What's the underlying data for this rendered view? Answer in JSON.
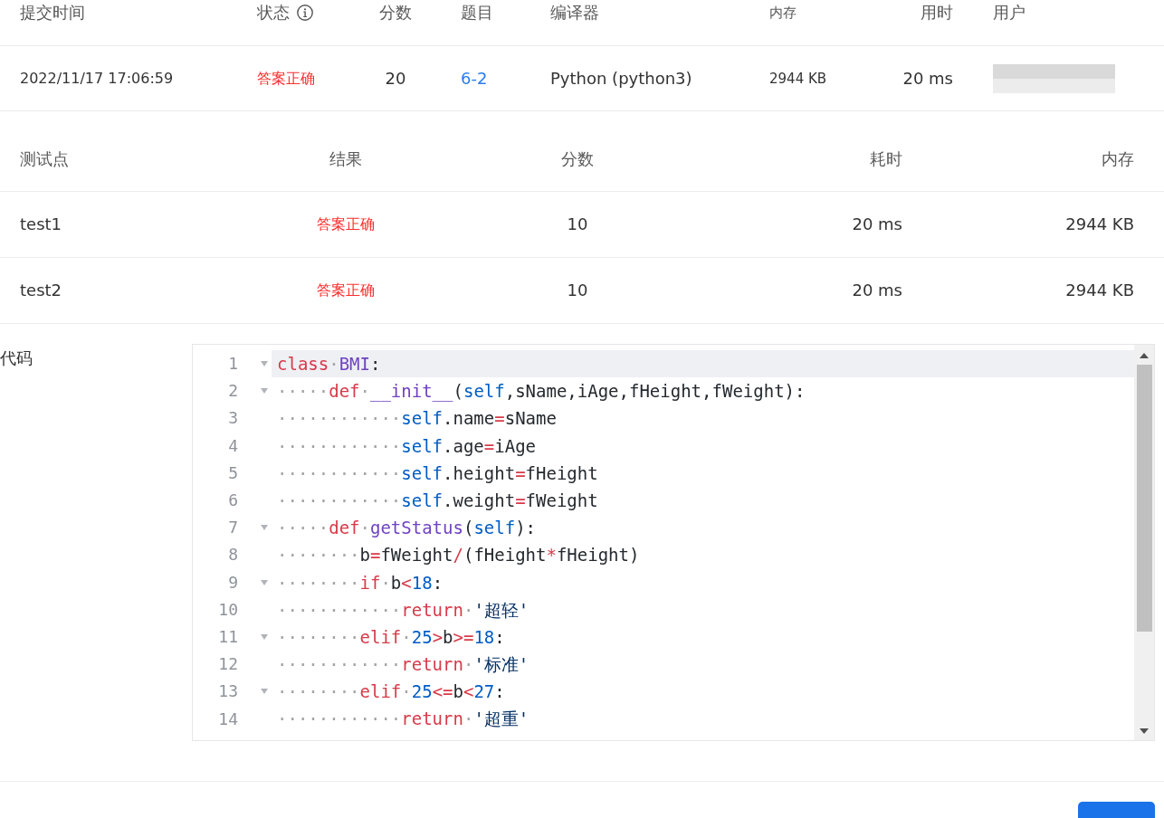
{
  "submission_table": {
    "columns": [
      {
        "label": "提交时间",
        "info": false
      },
      {
        "label": "状态",
        "info": true
      },
      {
        "label": "分数",
        "info": false
      },
      {
        "label": "题目",
        "info": false
      },
      {
        "label": "编译器",
        "info": false
      },
      {
        "label": "内存",
        "info": false
      },
      {
        "label": "用时",
        "info": false
      },
      {
        "label": "用户",
        "info": false
      }
    ],
    "rows": [
      {
        "cells": [
          {
            "kind": "plain",
            "text": "2022/11/17 17:06:59"
          },
          {
            "kind": "status",
            "text": "答案正确"
          },
          {
            "kind": "plain",
            "text": "20"
          },
          {
            "kind": "link",
            "text": "6-2"
          },
          {
            "kind": "plain",
            "text": "Python (python3)"
          },
          {
            "kind": "plain",
            "text": "2944 KB"
          },
          {
            "kind": "plain",
            "text": "20 ms"
          },
          {
            "kind": "blurred"
          }
        ]
      }
    ]
  },
  "test_table": {
    "columns": [
      "测试点",
      "结果",
      "分数",
      "耗时",
      "内存"
    ],
    "rows": [
      {
        "cells": [
          {
            "kind": "plain",
            "text": "test1"
          },
          {
            "kind": "status",
            "text": "答案正确"
          },
          {
            "kind": "plain",
            "text": "10"
          },
          {
            "kind": "plain",
            "text": "20 ms"
          },
          {
            "kind": "plain",
            "text": "2944 KB"
          }
        ]
      },
      {
        "cells": [
          {
            "kind": "plain",
            "text": "test2"
          },
          {
            "kind": "status",
            "text": "答案正确"
          },
          {
            "kind": "plain",
            "text": "10"
          },
          {
            "kind": "plain",
            "text": "20 ms"
          },
          {
            "kind": "plain",
            "text": "2944 KB"
          }
        ]
      }
    ]
  },
  "code": {
    "label": "代码",
    "lines": [
      {
        "number": "1",
        "foldable": true,
        "active": true,
        "tokens": [
          {
            "kind": "keyword",
            "text": "class"
          },
          {
            "kind": "ws",
            "text": "·"
          },
          {
            "kind": "name",
            "text": "BMI"
          },
          {
            "kind": "plain",
            "text": ":"
          }
        ]
      },
      {
        "number": "2",
        "foldable": true,
        "active": false,
        "tokens": [
          {
            "kind": "ws",
            "text": "·····"
          },
          {
            "kind": "keyword",
            "text": "def"
          },
          {
            "kind": "ws",
            "text": "·"
          },
          {
            "kind": "name",
            "text": "__init__"
          },
          {
            "kind": "plain",
            "text": "("
          },
          {
            "kind": "self",
            "text": "self"
          },
          {
            "kind": "plain",
            "text": ",sName,iAge,fHeight,fWeight):"
          }
        ]
      },
      {
        "number": "3",
        "foldable": false,
        "active": false,
        "tokens": [
          {
            "kind": "ws",
            "text": "············"
          },
          {
            "kind": "self",
            "text": "self"
          },
          {
            "kind": "plain",
            "text": ".name"
          },
          {
            "kind": "op",
            "text": "="
          },
          {
            "kind": "plain",
            "text": "sName"
          }
        ]
      },
      {
        "number": "4",
        "foldable": false,
        "active": false,
        "tokens": [
          {
            "kind": "ws",
            "text": "············"
          },
          {
            "kind": "self",
            "text": "self"
          },
          {
            "kind": "plain",
            "text": ".age"
          },
          {
            "kind": "op",
            "text": "="
          },
          {
            "kind": "plain",
            "text": "iAge"
          }
        ]
      },
      {
        "number": "5",
        "foldable": false,
        "active": false,
        "tokens": [
          {
            "kind": "ws",
            "text": "············"
          },
          {
            "kind": "self",
            "text": "self"
          },
          {
            "kind": "plain",
            "text": ".height"
          },
          {
            "kind": "op",
            "text": "="
          },
          {
            "kind": "plain",
            "text": "fHeight"
          }
        ]
      },
      {
        "number": "6",
        "foldable": false,
        "active": false,
        "tokens": [
          {
            "kind": "ws",
            "text": "············"
          },
          {
            "kind": "self",
            "text": "self"
          },
          {
            "kind": "plain",
            "text": ".weight"
          },
          {
            "kind": "op",
            "text": "="
          },
          {
            "kind": "plain",
            "text": "fWeight"
          }
        ]
      },
      {
        "number": "7",
        "foldable": true,
        "active": false,
        "tokens": [
          {
            "kind": "ws",
            "text": "·····"
          },
          {
            "kind": "keyword",
            "text": "def"
          },
          {
            "kind": "ws",
            "text": "·"
          },
          {
            "kind": "name",
            "text": "getStatus"
          },
          {
            "kind": "plain",
            "text": "("
          },
          {
            "kind": "self",
            "text": "self"
          },
          {
            "kind": "plain",
            "text": "):"
          }
        ]
      },
      {
        "number": "8",
        "foldable": false,
        "active": false,
        "tokens": [
          {
            "kind": "ws",
            "text": "········"
          },
          {
            "kind": "plain",
            "text": "b"
          },
          {
            "kind": "op",
            "text": "="
          },
          {
            "kind": "plain",
            "text": "fWeight"
          },
          {
            "kind": "op",
            "text": "/"
          },
          {
            "kind": "plain",
            "text": "(fHeight"
          },
          {
            "kind": "op",
            "text": "*"
          },
          {
            "kind": "plain",
            "text": "fHeight)"
          }
        ]
      },
      {
        "number": "9",
        "foldable": true,
        "active": false,
        "tokens": [
          {
            "kind": "ws",
            "text": "········"
          },
          {
            "kind": "keyword",
            "text": "if"
          },
          {
            "kind": "ws",
            "text": "·"
          },
          {
            "kind": "plain",
            "text": "b"
          },
          {
            "kind": "op",
            "text": "<"
          },
          {
            "kind": "number",
            "text": "18"
          },
          {
            "kind": "plain",
            "text": ":"
          }
        ]
      },
      {
        "number": "10",
        "foldable": false,
        "active": false,
        "tokens": [
          {
            "kind": "ws",
            "text": "············"
          },
          {
            "kind": "keyword",
            "text": "return"
          },
          {
            "kind": "ws",
            "text": "·"
          },
          {
            "kind": "string",
            "text": "'超轻'"
          }
        ]
      },
      {
        "number": "11",
        "foldable": true,
        "active": false,
        "tokens": [
          {
            "kind": "ws",
            "text": "········"
          },
          {
            "kind": "keyword",
            "text": "elif"
          },
          {
            "kind": "ws",
            "text": "·"
          },
          {
            "kind": "number",
            "text": "25"
          },
          {
            "kind": "op",
            "text": ">"
          },
          {
            "kind": "plain",
            "text": "b"
          },
          {
            "kind": "op",
            "text": ">="
          },
          {
            "kind": "number",
            "text": "18"
          },
          {
            "kind": "plain",
            "text": ":"
          }
        ]
      },
      {
        "number": "12",
        "foldable": false,
        "active": false,
        "tokens": [
          {
            "kind": "ws",
            "text": "············"
          },
          {
            "kind": "keyword",
            "text": "return"
          },
          {
            "kind": "ws",
            "text": "·"
          },
          {
            "kind": "string",
            "text": "'标准'"
          }
        ]
      },
      {
        "number": "13",
        "foldable": true,
        "active": false,
        "tokens": [
          {
            "kind": "ws",
            "text": "········"
          },
          {
            "kind": "keyword",
            "text": "elif"
          },
          {
            "kind": "ws",
            "text": "·"
          },
          {
            "kind": "number",
            "text": "25"
          },
          {
            "kind": "op",
            "text": "<="
          },
          {
            "kind": "plain",
            "text": "b"
          },
          {
            "kind": "op",
            "text": "<"
          },
          {
            "kind": "number",
            "text": "27"
          },
          {
            "kind": "plain",
            "text": ":"
          }
        ]
      },
      {
        "number": "14",
        "foldable": false,
        "active": false,
        "tokens": [
          {
            "kind": "ws",
            "text": "············"
          },
          {
            "kind": "keyword",
            "text": "return"
          },
          {
            "kind": "ws",
            "text": "·"
          },
          {
            "kind": "string",
            "text": "'超重'"
          }
        ]
      }
    ]
  }
}
